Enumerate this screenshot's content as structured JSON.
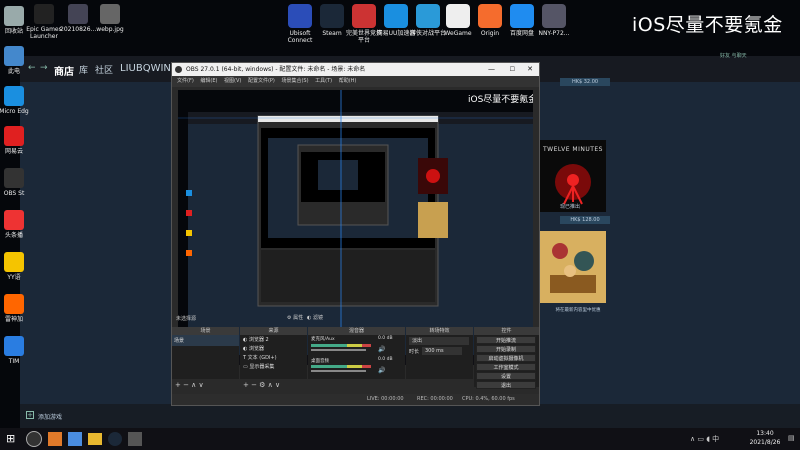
{
  "watermark": "iOS尽量不要氪金",
  "desktop_left": [
    {
      "label": "回收站",
      "color": "#9aa"
    },
    {
      "label": "此电",
      "color": "#48c"
    },
    {
      "label": "Micro Edg",
      "color": "#1a8fe0"
    },
    {
      "label": "网易云",
      "color": "#e02020"
    },
    {
      "label": "OBS St",
      "color": "#333"
    },
    {
      "label": "头条播",
      "color": "#e33"
    },
    {
      "label": "YY语",
      "color": "#f5c400"
    },
    {
      "label": "雷神加",
      "color": "#f60"
    },
    {
      "label": "TIM",
      "color": "#2a7de1"
    }
  ],
  "desktop_top_left": [
    {
      "label": "Epic Games Launcher",
      "color": "#222"
    },
    {
      "label": "20210826...",
      "color": "#445"
    },
    {
      "label": "webp.jpg",
      "color": "#666"
    }
  ],
  "desktop_top": [
    {
      "label": "Ubisoft Connect",
      "color": "#2b4db8"
    },
    {
      "label": "Steam",
      "color": "#1b2838"
    },
    {
      "label": "完美世界竞技平台",
      "color": "#c33"
    },
    {
      "label": "网易UU加速器",
      "color": "#1a8fe0"
    },
    {
      "label": "游侠对战平台",
      "color": "#2a9ad8"
    },
    {
      "label": "WeGame",
      "color": "#eee"
    },
    {
      "label": "Origin",
      "color": "#f56c2d"
    },
    {
      "label": "百度网盘",
      "color": "#1f8cf0"
    },
    {
      "label": "NNY-P72...",
      "color": "#556"
    }
  ],
  "steam": {
    "nav": [
      "商店",
      "库",
      "社区",
      "LIUBQWIN"
    ],
    "game1_title": "TWELVE MINUTES",
    "game1_label": "现已推出",
    "game1_price": "HK$ 128.00",
    "game2_label": "将在最新内容里中优惠",
    "price_top": "HK$ 32.00",
    "add_game": "添加游戏",
    "corner_right": "好友 与聊天"
  },
  "obs": {
    "title": "OBS 27.0.1 (64-bit, windows) - 配置文件: 未命名 - 场景: 未命名",
    "menu": [
      "文件(F)",
      "编辑(E)",
      "视图(V)",
      "配置文件(P)",
      "场景集合(S)",
      "工具(T)",
      "帮助(H)"
    ],
    "no_source": "未选择源",
    "props": "属性",
    "filters": "滤镜",
    "docks": [
      "场景",
      "来源",
      "混音器",
      "转场特效",
      "控件"
    ],
    "scene": "场景",
    "sources": [
      "浏览器 2",
      "浏览器",
      "文本 (GDI+)",
      "显示器采集"
    ],
    "mixer": [
      {
        "name": "麦克风/Aux",
        "db": "0.0 dB"
      },
      {
        "name": "桌面音频",
        "db": "0.0 dB"
      }
    ],
    "transition": "淡出",
    "duration_label": "时长",
    "duration": "300 ms",
    "controls": [
      "开始推流",
      "开始录制",
      "启动虚拟摄像机",
      "工作室模式",
      "设置",
      "退出"
    ],
    "status": [
      "LIVE: 00:00:00",
      "REC: 00:00:00",
      "CPU: 0.4%, 60.00 fps"
    ]
  },
  "taskbar": {
    "time": "13:40",
    "date": "2021/8/26"
  }
}
